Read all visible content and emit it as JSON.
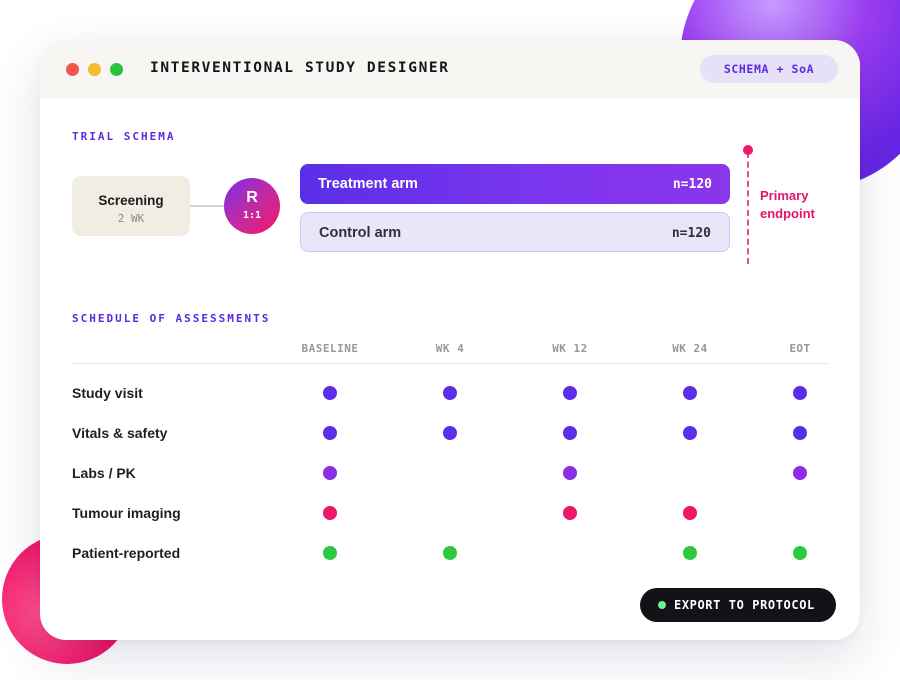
{
  "window": {
    "title": "INTERVENTIONAL STUDY DESIGNER",
    "mode_pill": "SCHEMA + SoA"
  },
  "schema": {
    "section_label": "TRIAL SCHEMA",
    "screening": {
      "label": "Screening",
      "duration": "2 WK"
    },
    "randomization": {
      "letter": "R",
      "ratio": "1:1"
    },
    "arms": [
      {
        "name": "Treatment arm",
        "n": "n=120"
      },
      {
        "name": "Control arm",
        "n": "n=120"
      }
    ],
    "endpoint_label": "Primary endpoint"
  },
  "soa": {
    "section_label": "SCHEDULE OF ASSESSMENTS",
    "columns": [
      "BASELINE",
      "WK 4",
      "WK 12",
      "WK 24",
      "EOT"
    ],
    "rows": [
      {
        "label": "Study visit",
        "color": "#5b2ee8",
        "marks": [
          1,
          1,
          1,
          1,
          1
        ]
      },
      {
        "label": "Vitals & safety",
        "color": "#5b2ee8",
        "marks": [
          1,
          1,
          1,
          1,
          1
        ]
      },
      {
        "label": "Labs / PK",
        "color": "#8a2fe6",
        "marks": [
          1,
          0,
          1,
          0,
          1
        ]
      },
      {
        "label": "Tumour imaging",
        "color": "#f0166a",
        "marks": [
          1,
          0,
          1,
          1,
          0
        ]
      },
      {
        "label": "Patient-reported",
        "color": "#2ec840",
        "marks": [
          1,
          1,
          0,
          1,
          1
        ]
      }
    ]
  },
  "export_button": {
    "label": "EXPORT TO PROTOCOL",
    "status_color": "#6ef08c"
  },
  "colors": {
    "accent": "#5b2be0",
    "endpoint": "#f0166a",
    "titlebar": "#f8f6f2"
  }
}
